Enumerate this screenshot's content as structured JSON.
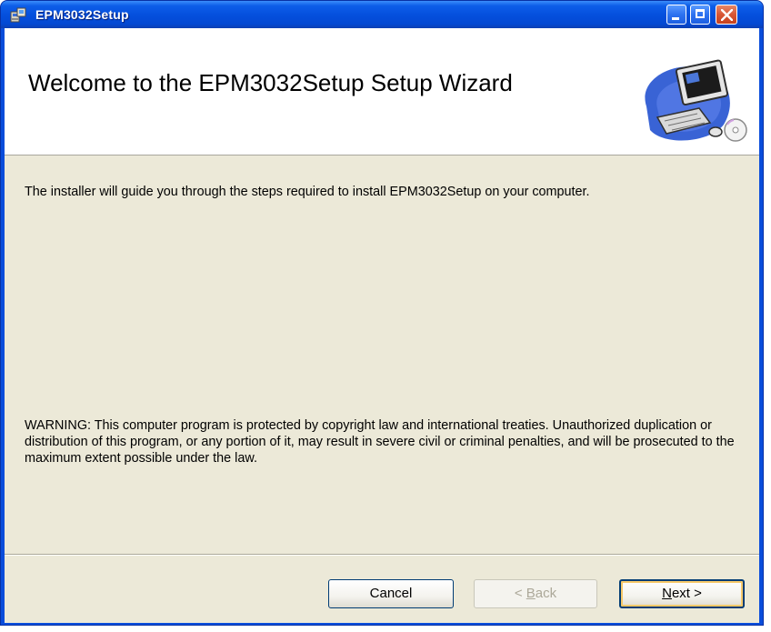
{
  "window": {
    "title": "EPM3032Setup"
  },
  "banner": {
    "title": "Welcome to the EPM3032Setup Setup Wizard"
  },
  "body": {
    "intro": "The installer will guide you through the steps required to install EPM3032Setup on your computer.",
    "warning": "WARNING: This computer program is protected by copyright law and international treaties. Unauthorized duplication or distribution of this program, or any portion of it, may result in severe civil or criminal penalties, and will be prosecuted to the maximum extent possible under the law."
  },
  "buttons": {
    "cancel": "Cancel",
    "back_prefix": "< ",
    "back_accel": "B",
    "back_rest": "ack",
    "next_accel": "N",
    "next_rest": "ext >"
  },
  "colors": {
    "titlebar": "#0550de",
    "client": "#ece9d8",
    "close_button": "#d85634"
  },
  "icons": {
    "title": "installer-package-icon",
    "banner": "computer-with-disc-icon",
    "minimize": "minimize-icon",
    "maximize": "maximize-icon",
    "close": "close-icon"
  }
}
